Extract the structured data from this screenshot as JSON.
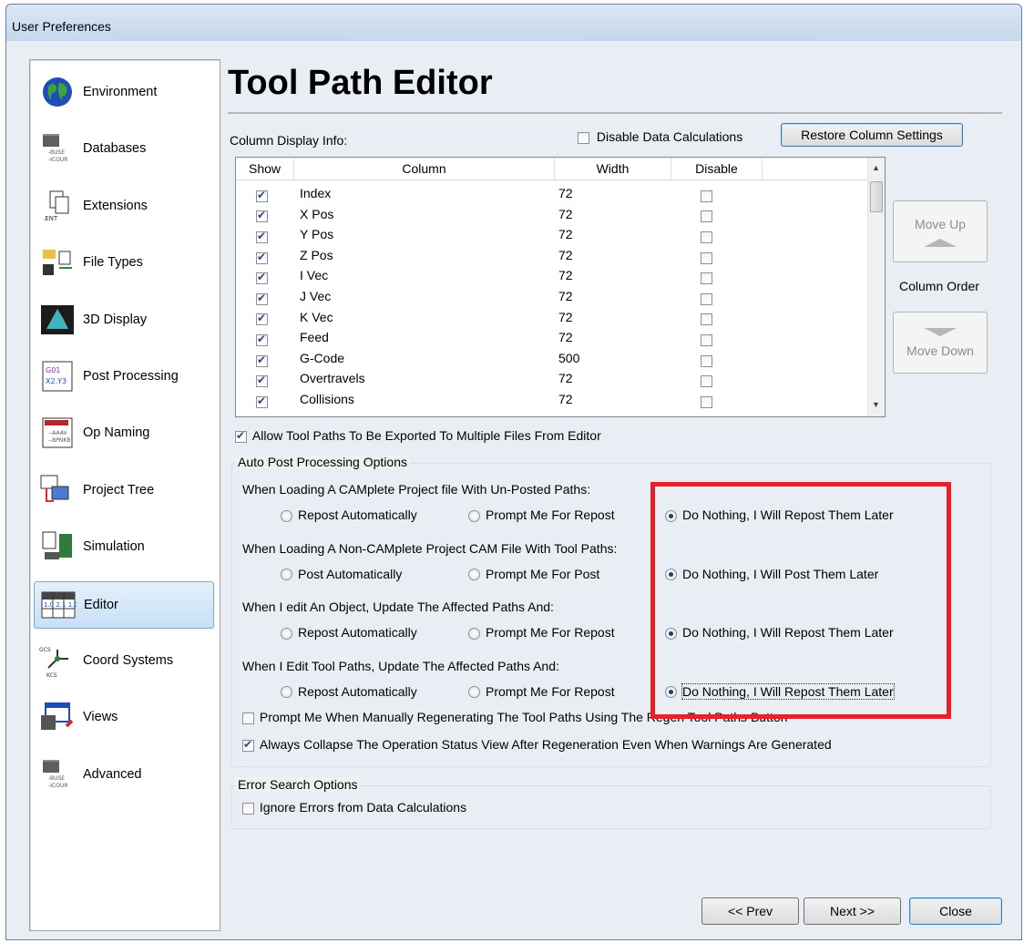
{
  "window": {
    "title": "User Preferences"
  },
  "sidebar": {
    "items": [
      {
        "label": "Environment",
        "icon": "globe-icon"
      },
      {
        "label": "Databases",
        "icon": "database-folder-icon"
      },
      {
        "label": "Extensions",
        "icon": "extension-files-icon"
      },
      {
        "label": "File Types",
        "icon": "file-types-icon"
      },
      {
        "label": "3D Display",
        "icon": "3d-display-icon"
      },
      {
        "label": "Post Processing",
        "icon": "post-processing-icon"
      },
      {
        "label": "Op Naming",
        "icon": "op-naming-icon"
      },
      {
        "label": "Project Tree",
        "icon": "project-tree-icon"
      },
      {
        "label": "Simulation",
        "icon": "simulation-icon"
      },
      {
        "label": "Editor",
        "icon": "editor-grid-icon"
      },
      {
        "label": "Coord Systems",
        "icon": "coord-systems-icon"
      },
      {
        "label": "Views",
        "icon": "views-icon"
      },
      {
        "label": "Advanced",
        "icon": "advanced-folder-icon"
      }
    ],
    "selected": "Editor"
  },
  "page": {
    "title": "Tool Path Editor"
  },
  "columns": {
    "section_label": "Column Display Info:",
    "disable_calc_label": "Disable Data Calculations",
    "restore_button": "Restore Column Settings",
    "headers": [
      "Show",
      "Column",
      "Width",
      "Disable"
    ],
    "rows": [
      {
        "show": true,
        "column": "Index",
        "width": "72",
        "disable": false
      },
      {
        "show": true,
        "column": "X Pos",
        "width": "72",
        "disable": false
      },
      {
        "show": true,
        "column": "Y Pos",
        "width": "72",
        "disable": false
      },
      {
        "show": true,
        "column": "Z Pos",
        "width": "72",
        "disable": false
      },
      {
        "show": true,
        "column": "I Vec",
        "width": "72",
        "disable": false
      },
      {
        "show": true,
        "column": "J Vec",
        "width": "72",
        "disable": false
      },
      {
        "show": true,
        "column": "K Vec",
        "width": "72",
        "disable": false
      },
      {
        "show": true,
        "column": "Feed",
        "width": "72",
        "disable": false
      },
      {
        "show": true,
        "column": "G-Code",
        "width": "500",
        "disable": false
      },
      {
        "show": true,
        "column": "Overtravels",
        "width": "72",
        "disable": false
      },
      {
        "show": true,
        "column": "Collisions",
        "width": "72",
        "disable": false
      }
    ],
    "move_up": "Move Up",
    "column_order": "Column Order",
    "move_down": "Move Down"
  },
  "export_multi": {
    "label": "Allow Tool Paths To Be Exported To Multiple Files From Editor",
    "checked": true
  },
  "auto_post": {
    "legend": "Auto Post Processing Options",
    "groups": [
      {
        "question": "When Loading A CAMplete Project file With Un-Posted Paths:",
        "options": [
          "Repost Automatically",
          "Prompt Me For Repost",
          "Do Nothing, I Will Repost Them Later"
        ],
        "selected": 2
      },
      {
        "question": "When Loading A Non-CAMplete Project CAM File With Tool Paths:",
        "options": [
          "Post Automatically",
          "Prompt Me For Post",
          "Do Nothing, I Will Post Them Later"
        ],
        "selected": 2
      },
      {
        "question": "When I edit An Object, Update The Affected Paths And:",
        "options": [
          "Repost Automatically",
          "Prompt Me For Repost",
          "Do Nothing, I Will Repost Them Later"
        ],
        "selected": 2
      },
      {
        "question": "When I Edit Tool Paths, Update The Affected Paths And:",
        "options": [
          "Repost Automatically",
          "Prompt Me For Repost",
          "Do Nothing, I Will Repost Them Later"
        ],
        "selected": 2
      }
    ],
    "prompt_regen": {
      "label": "Prompt Me When Manually Regenerating The Tool Paths Using The Regen Tool Paths Button",
      "checked": false
    },
    "collapse_status": {
      "label": "Always Collapse The Operation Status View After Regeneration Even When Warnings Are Generated",
      "checked": true
    }
  },
  "error_search": {
    "legend": "Error Search Options",
    "ignore_errors": {
      "label": "Ignore Errors from Data Calculations",
      "checked": false
    }
  },
  "footer": {
    "prev": "<< Prev",
    "next": "Next >>",
    "close": "Close"
  },
  "colors": {
    "highlight_box": "#e8202a",
    "selected_nav": "#c7e0f7"
  }
}
